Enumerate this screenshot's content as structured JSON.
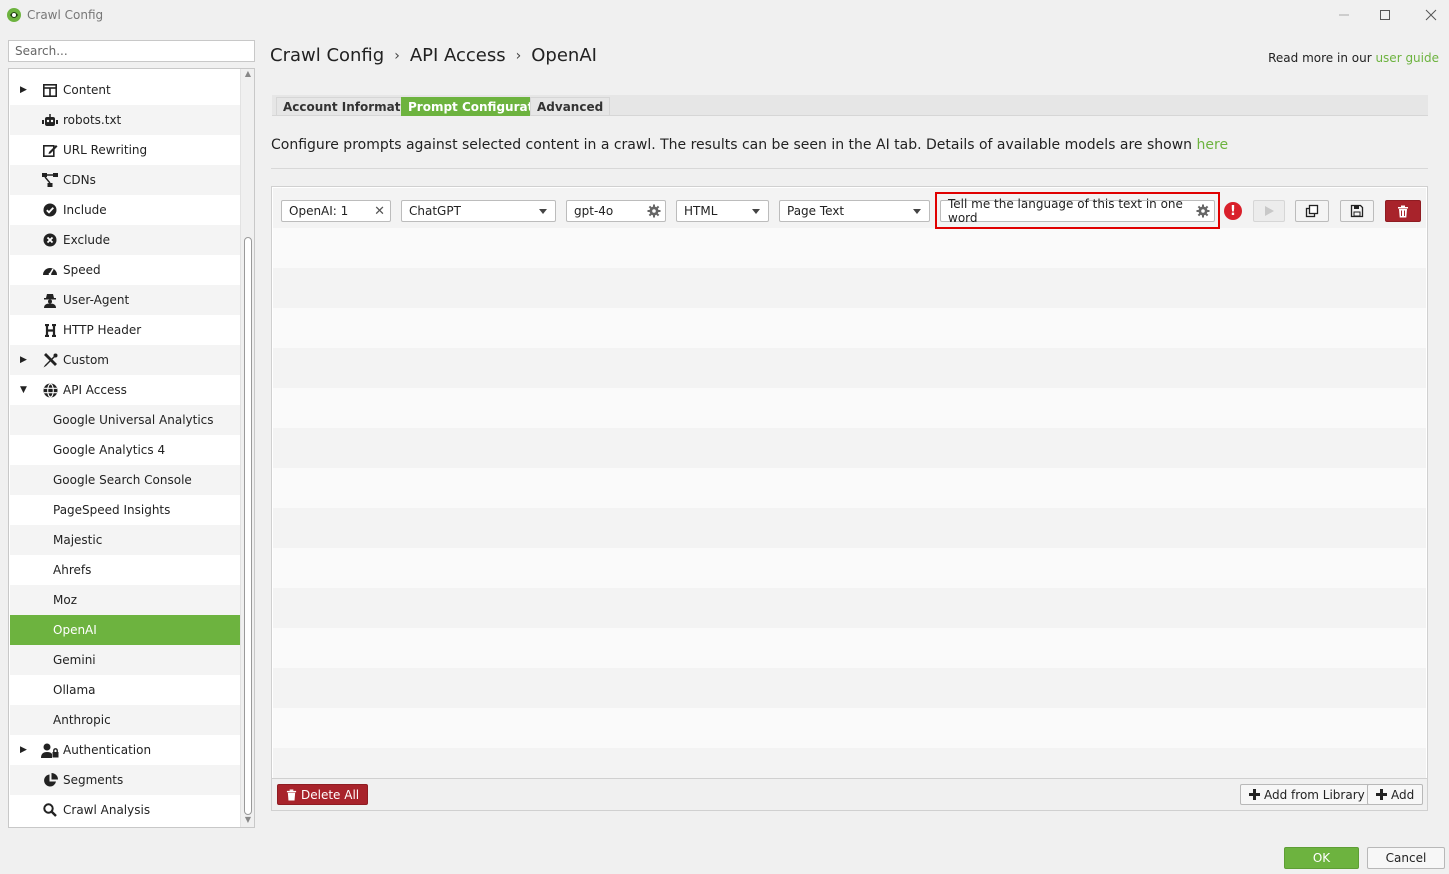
{
  "window": {
    "title": "Crawl Config"
  },
  "search": {
    "placeholder": "Search..."
  },
  "sidebar": {
    "items": [
      {
        "label": "Content",
        "icon": "columns-icon",
        "expandable": "▶"
      },
      {
        "label": "robots.txt",
        "icon": "robot-icon"
      },
      {
        "label": "URL Rewriting",
        "icon": "edit-icon"
      },
      {
        "label": "CDNs",
        "icon": "network-icon"
      },
      {
        "label": "Include",
        "icon": "check-circle-icon"
      },
      {
        "label": "Exclude",
        "icon": "x-circle-icon"
      },
      {
        "label": "Speed",
        "icon": "gauge-icon"
      },
      {
        "label": "User-Agent",
        "icon": "user-secret-icon"
      },
      {
        "label": "HTTP Header",
        "icon": "heading-icon"
      },
      {
        "label": "Custom",
        "icon": "tools-icon",
        "expandable": "▶"
      },
      {
        "label": "API Access",
        "icon": "globe-icon",
        "expandable": "▼"
      },
      {
        "label": "Google Universal Analytics"
      },
      {
        "label": "Google Analytics 4"
      },
      {
        "label": "Google Search Console"
      },
      {
        "label": "PageSpeed Insights"
      },
      {
        "label": "Majestic"
      },
      {
        "label": "Ahrefs"
      },
      {
        "label": "Moz"
      },
      {
        "label": "OpenAI",
        "selected": true
      },
      {
        "label": "Gemini"
      },
      {
        "label": "Ollama"
      },
      {
        "label": "Anthropic"
      },
      {
        "label": "Authentication",
        "icon": "user-lock-icon",
        "expandable": "▶"
      },
      {
        "label": "Segments",
        "icon": "pie-chart-icon"
      },
      {
        "label": "Crawl Analysis",
        "icon": "search-icon"
      }
    ]
  },
  "breadcrumb": {
    "part1": "Crawl Config",
    "part2": "API Access",
    "part3": "OpenAI",
    "sep": "›"
  },
  "read_more": {
    "text": "Read more in our",
    "link": "user guide"
  },
  "tabs": {
    "account": "Account Information",
    "prompt": "Prompt Configuration",
    "advanced": "Advanced"
  },
  "description": {
    "text": "Configure prompts against selected content in a crawl. The results can be seen in the AI tab. Details of available models are shown",
    "link": "here"
  },
  "prompt_row": {
    "name": "OpenAI: 1",
    "provider": "ChatGPT",
    "model": "gpt-4o",
    "content_type": "HTML",
    "content_source": "Page Text",
    "prompt": "Tell me the language of this text in one word"
  },
  "footer": {
    "delete_all": "Delete All",
    "add_from_library": "Add from Library",
    "add": "Add"
  },
  "dialog": {
    "ok": "OK",
    "cancel": "Cancel"
  },
  "colors": {
    "accent": "#6db33f",
    "danger": "#a8232b",
    "highlight": "#e00000"
  }
}
